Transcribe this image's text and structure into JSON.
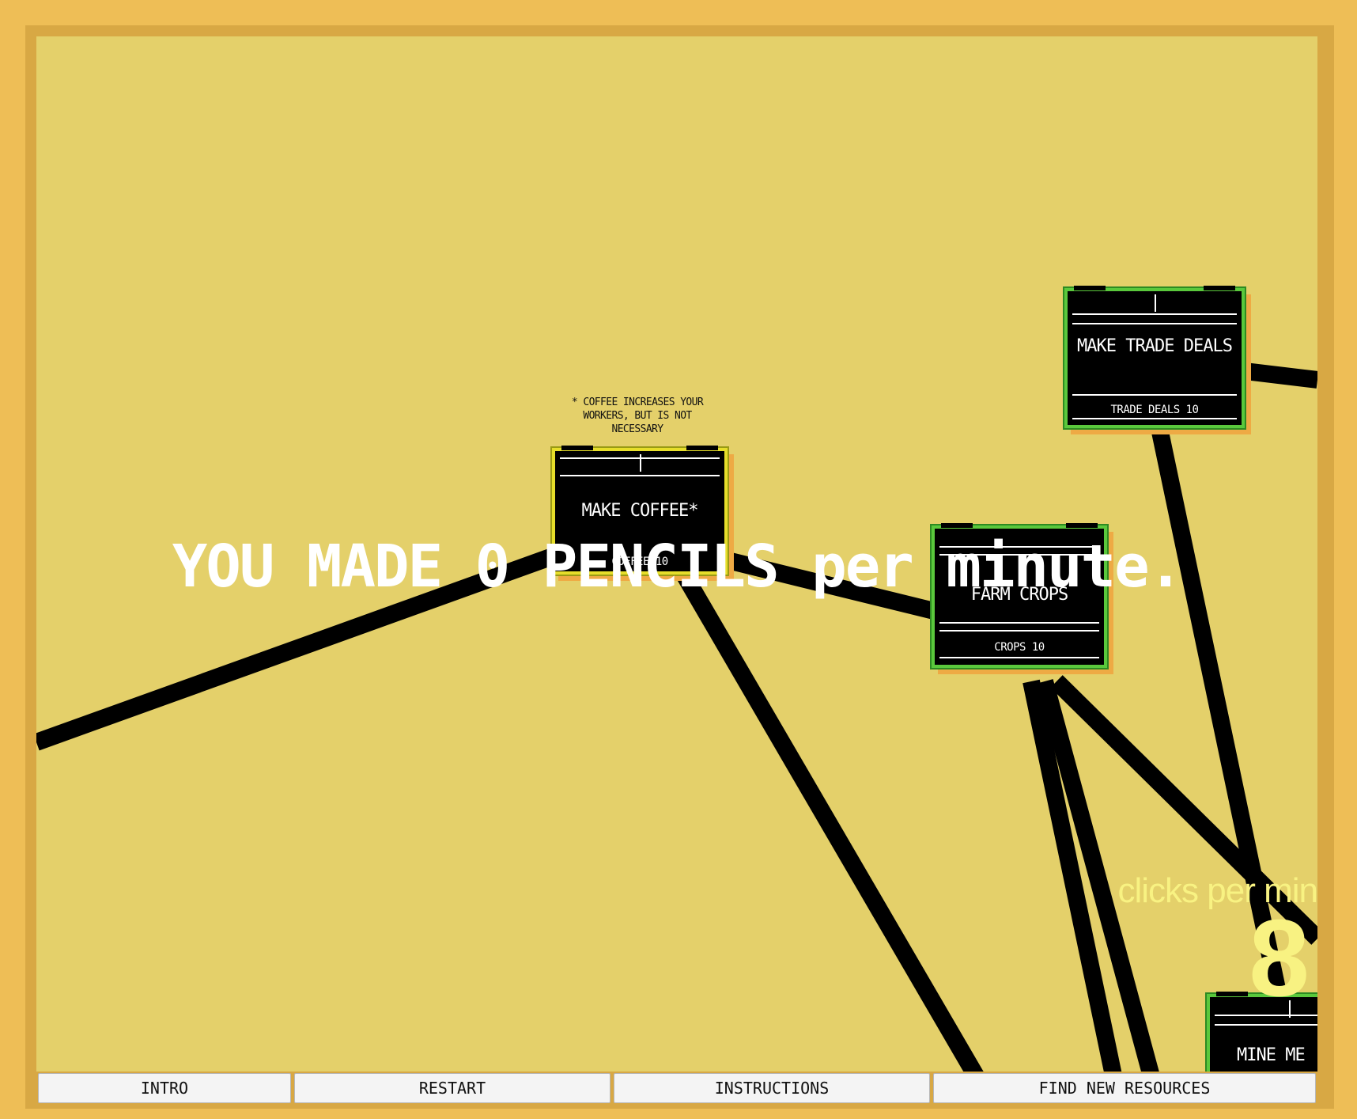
{
  "message": {
    "text": "YOU MADE 0 PENCILS per minute."
  },
  "nodes": {
    "make_trade_deals": {
      "title": "MAKE TRADE DEALS",
      "count": "TRADE DEALS 10"
    },
    "make_coffee": {
      "title": "MAKE COFFEE*",
      "count": "COFFEE 10"
    },
    "farm_crops": {
      "title": "FARM CROPS",
      "count": "CROPS 10"
    },
    "mine_metal": {
      "title": "MINE ME"
    }
  },
  "coffee_note": "* COFFEE INCREASES YOUR WORKERS, BUT IS NOT NECESSARY",
  "stats": {
    "clicks_label": "clicks per min",
    "clicks_value": "8"
  },
  "navigation": {
    "intro": "INTRO",
    "restart": "RESTART",
    "instructions": "INSTRUCTIONS",
    "find_new_resources": "FIND NEW RESOURCES"
  },
  "colors": {
    "background": "#e4d06a",
    "border": "#eebe56",
    "node_active": "#5ac83c",
    "node_selected": "#e6de2a",
    "message_text": "#ffffff",
    "stat_text": "#f8f282"
  }
}
